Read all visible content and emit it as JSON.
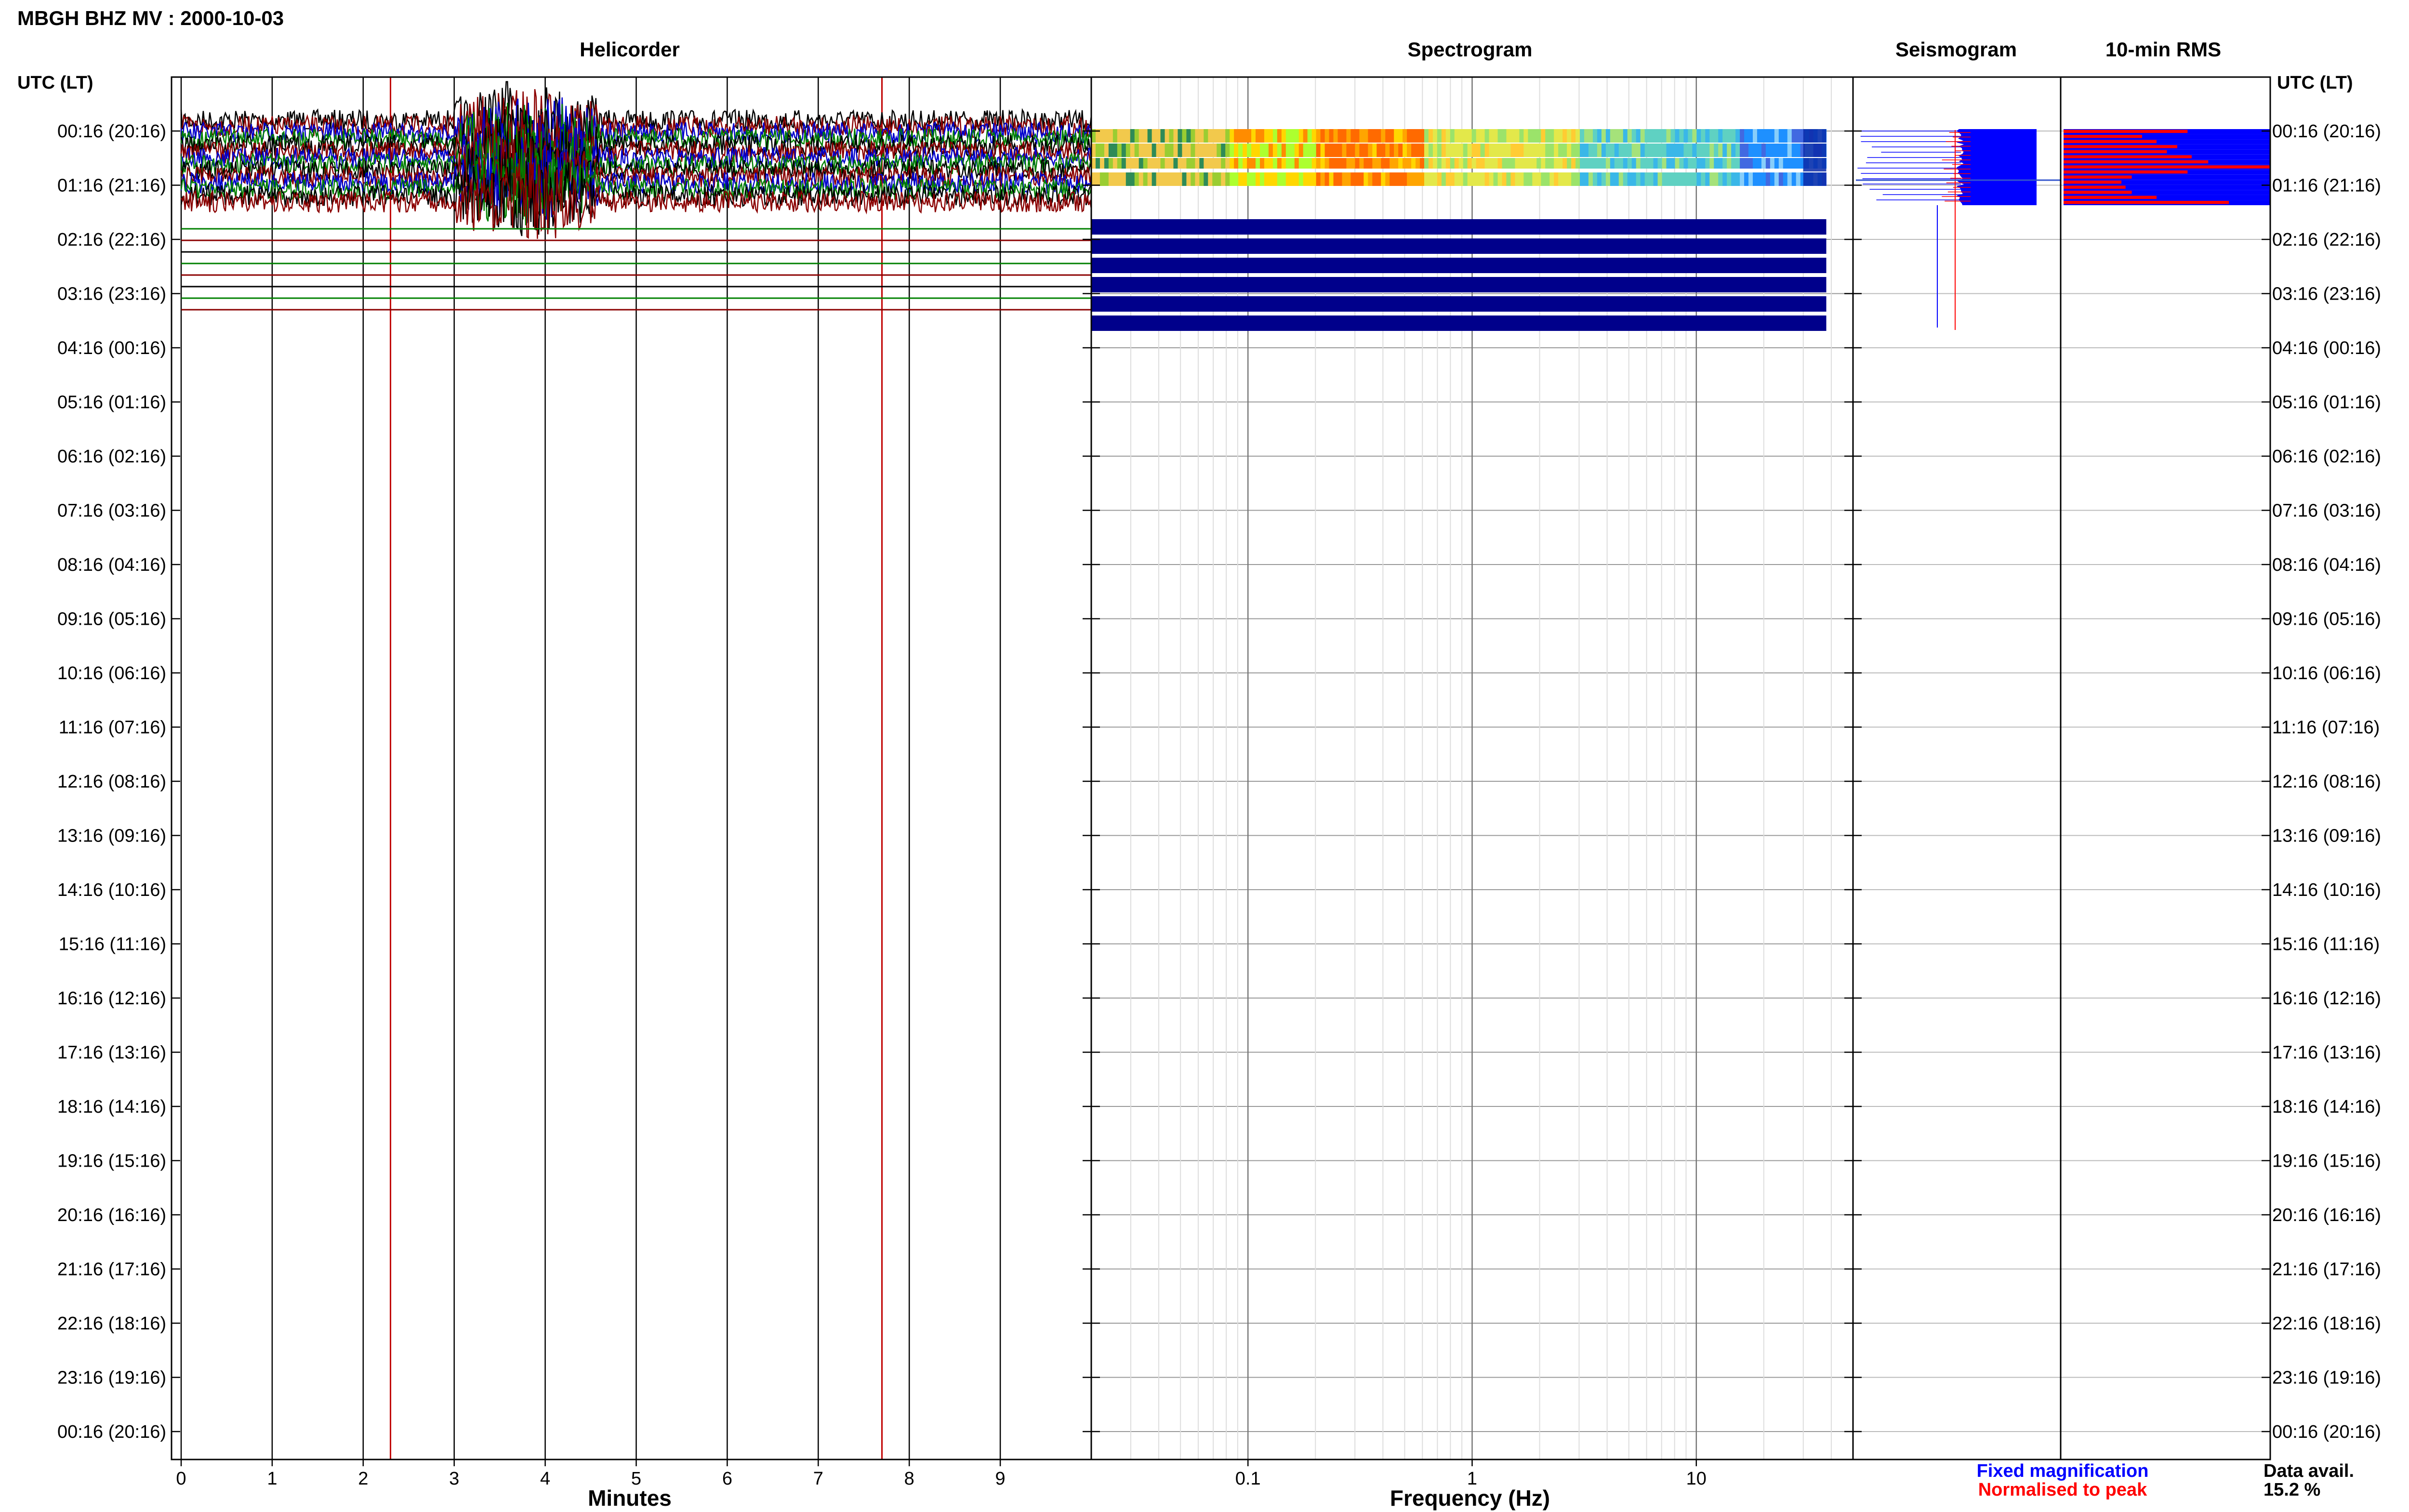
{
  "title": "MBGH BHZ MV : 2000-10-03",
  "row_header_left": "UTC (LT)",
  "row_header_right": "UTC (LT)",
  "row_labels": [
    "00:16 (20:16)",
    "01:16 (21:16)",
    "02:16 (22:16)",
    "03:16 (23:16)",
    "04:16 (00:16)",
    "05:16 (01:16)",
    "06:16 (02:16)",
    "07:16 (03:16)",
    "08:16 (04:16)",
    "09:16 (05:16)",
    "10:16 (06:16)",
    "11:16 (07:16)",
    "12:16 (08:16)",
    "13:16 (09:16)",
    "14:16 (10:16)",
    "15:16 (11:16)",
    "16:16 (12:16)",
    "17:16 (13:16)",
    "18:16 (14:16)",
    "19:16 (15:16)",
    "20:16 (16:16)",
    "21:16 (17:16)",
    "22:16 (18:16)",
    "23:16 (19:16)",
    "00:16 (20:16)"
  ],
  "legend": {
    "fixed": "Fixed magnification",
    "fixed_color": "#0000ff",
    "normalised": "Normalised to peak",
    "normalised_color": "#ff0000"
  },
  "data_avail": {
    "label": "Data avail.",
    "value": "15.2 %"
  },
  "colors": {
    "trace_black": "#000000",
    "trace_green": "#008000",
    "trace_red": "#8b0000",
    "trace_blue": "#0000cc",
    "spectro_fill": "#00008b",
    "rms_blue": "#0000ff",
    "rms_red": "#ff0000"
  },
  "chart_data": [
    {
      "type": "line",
      "panel": "Helicorder",
      "title": "Helicorder",
      "xlabel": "Minutes",
      "xlim": [
        0,
        10
      ],
      "xticks": [
        "0",
        "1",
        "2",
        "3",
        "4",
        "5",
        "6",
        "7",
        "8",
        "9"
      ],
      "markers_minutes": [
        2.3,
        7.7
      ],
      "rows_with_waveform": 14,
      "rows_flat": 8,
      "event_window_minutes": [
        3.0,
        4.6
      ]
    },
    {
      "type": "heatmap",
      "panel": "Spectrogram",
      "title": "Spectrogram",
      "xlabel": "Frequency (Hz)",
      "xscale": "log",
      "xlim": [
        0.02,
        50
      ],
      "xticks": [
        "0.1",
        "1",
        "10"
      ],
      "colored_bands": 4,
      "dark_bands": 6,
      "energy_peak_hz": [
        0.2,
        0.6
      ]
    },
    {
      "type": "line",
      "panel": "Seismogram",
      "title": "Seismogram",
      "series": [
        {
          "name": "Fixed magnification",
          "color": "#0000ff"
        },
        {
          "name": "Normalised to peak",
          "color": "#ff0000"
        }
      ]
    },
    {
      "type": "bar",
      "panel": "10-min RMS",
      "title": "10-min RMS",
      "rows": 15,
      "fixed_magnification": [
        1,
        1,
        1,
        1,
        1,
        1,
        1,
        1,
        1,
        1,
        1,
        1,
        1,
        1,
        1
      ],
      "normalised_to_peak": [
        0.6,
        0.38,
        0.45,
        0.55,
        0.5,
        0.62,
        0.7,
        1.0,
        0.6,
        0.33,
        0.28,
        0.3,
        0.33,
        0.45,
        0.8
      ]
    }
  ]
}
